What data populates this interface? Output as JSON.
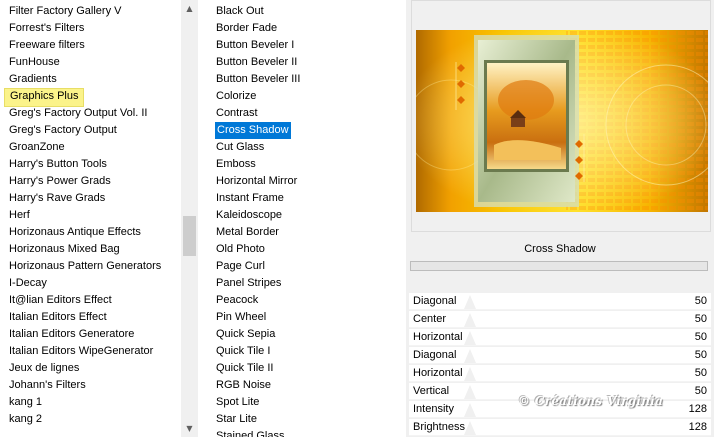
{
  "filters_list": {
    "items": [
      "Filter Factory Gallery V",
      "Forrest's Filters",
      "Freeware filters",
      "FunHouse",
      "Gradients",
      "Graphics Plus",
      "Greg's Factory Output Vol. II",
      "Greg's Factory Output",
      "GroanZone",
      "Harry's Button Tools",
      "Harry's Power Grads",
      "Harry's Rave Grads",
      "Herf",
      "Horizonaus Antique Effects",
      "Horizonaus Mixed Bag",
      "Horizonaus Pattern Generators",
      "I-Decay",
      "It@lian Editors Effect",
      "Italian Editors Effect",
      "Italian Editors Generatore",
      "Italian Editors WipeGenerator",
      "Jeux de lignes",
      "Johann's Filters",
      "kang 1",
      "kang 2"
    ],
    "hovered": "Graphics Plus"
  },
  "effects_list": {
    "items": [
      "Black Out",
      "Border Fade",
      "Button Beveler I",
      "Button Beveler II",
      "Button Beveler III",
      "Colorize",
      "Contrast",
      "Cross Shadow",
      "Cut Glass",
      "Emboss",
      "Horizontal Mirror",
      "Instant Frame",
      "Kaleidoscope",
      "Metal Border",
      "Old Photo",
      "Page Curl",
      "Panel Stripes",
      "Peacock",
      "Pin Wheel",
      "Quick Sepia",
      "Quick Tile I",
      "Quick Tile II",
      "RGB Noise",
      "Spot Lite",
      "Star Lite",
      "Stained Glass"
    ],
    "selected": "Cross Shadow"
  },
  "scroll_arrows": {
    "up": "▲",
    "down": "▼"
  },
  "filter_panel": {
    "title": "Cross Shadow",
    "params": [
      {
        "label": "Diagonal",
        "value": "50"
      },
      {
        "label": "Center",
        "value": "50"
      },
      {
        "label": "Horizontal",
        "value": "50"
      },
      {
        "label": "Diagonal",
        "value": "50"
      },
      {
        "label": "Horizontal",
        "value": "50"
      },
      {
        "label": "Vertical",
        "value": "50"
      },
      {
        "label": "Intensity",
        "value": "128"
      },
      {
        "label": "Brightness",
        "value": "128"
      }
    ]
  },
  "watermark": "© Créations Virginia",
  "colors": {
    "selection": "#0078d7",
    "hover": "#fbf38a",
    "preview_gold": "#f5a700",
    "preview_green": "#c9d9a8"
  }
}
